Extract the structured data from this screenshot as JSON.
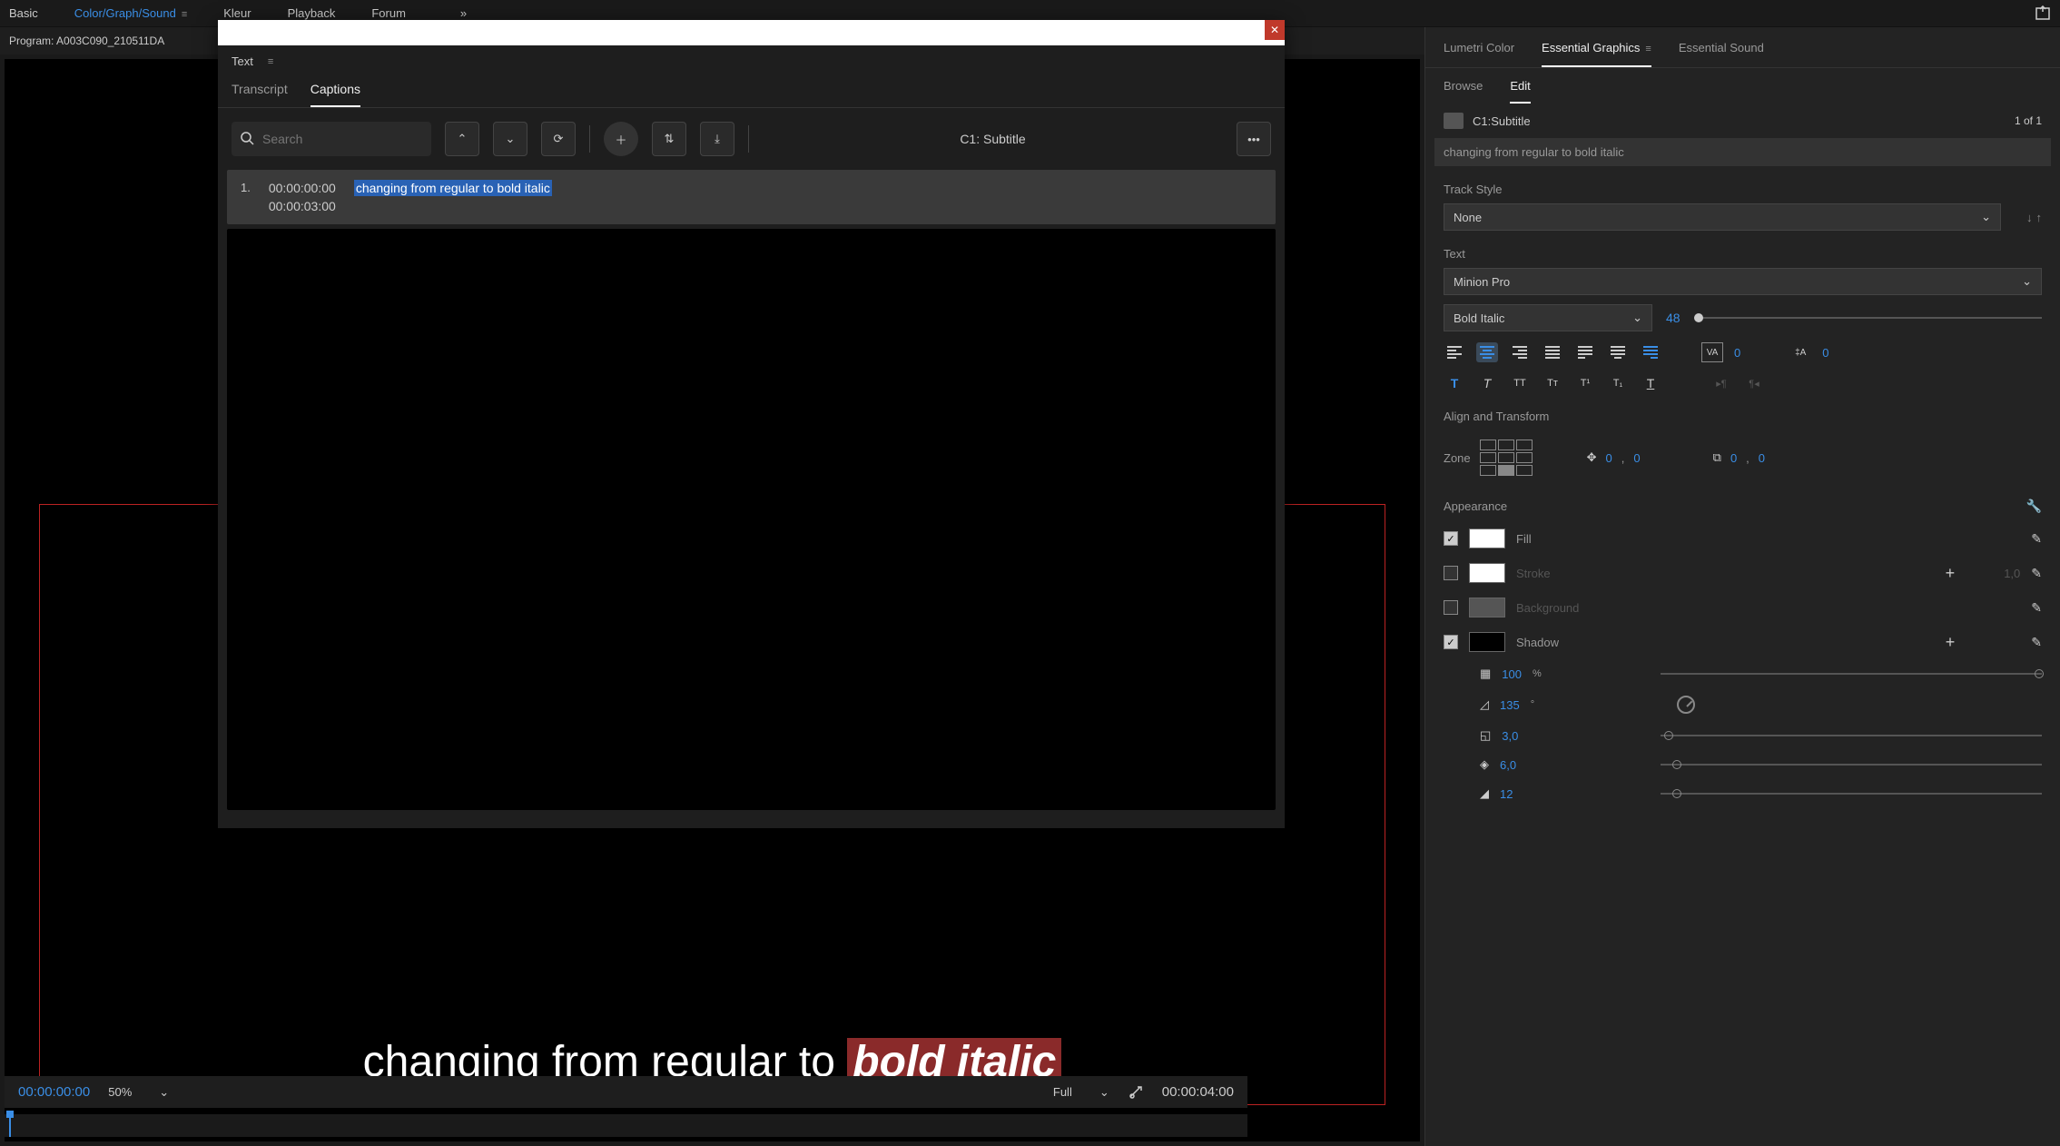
{
  "topbar": {
    "basic": "Basic",
    "cgs": "Color/Graph/Sound",
    "kleur": "Kleur",
    "playback": "Playback",
    "forum": "Forum"
  },
  "program_bar": "Program: A003C090_210511DA",
  "text_panel": {
    "title": "Text",
    "transcript": "Transcript",
    "captions": "Captions",
    "search_placeholder": "Search",
    "subtitle_track": "C1: Subtitle",
    "row_num": "1.",
    "in_tc": "00:00:00:00",
    "out_tc": "00:00:03:00",
    "caption_text": "changing from regular to bold italic"
  },
  "overlay": {
    "normal": "changing from regular to ",
    "bold": "bold italic"
  },
  "bottom": {
    "tc_left": "00:00:00:00",
    "zoom": "50%",
    "resolution": "Full",
    "tc_right": "00:00:04:00"
  },
  "right": {
    "lumetri": "Lumetri Color",
    "essential_graphics": "Essential Graphics",
    "essential_sound": "Essential Sound",
    "browse": "Browse",
    "edit": "Edit",
    "layer_name": "C1:Subtitle",
    "layer_count": "1 of 1",
    "layer_text": "changing from regular to bold italic",
    "track_style": "Track Style",
    "track_style_value": "None",
    "text_section": "Text",
    "font": "Minion Pro",
    "font_style": "Bold Italic",
    "font_size": "48",
    "tracking": "0",
    "leading": "0",
    "align_transform": "Align and Transform",
    "zone_label": "Zone",
    "pos_x": "0",
    "pos_y": "0",
    "scale_x": "0",
    "scale_y": "0",
    "appearance": "Appearance",
    "fill": "Fill",
    "stroke": "Stroke",
    "stroke_val": "1,0",
    "background": "Background",
    "shadow": "Shadow",
    "shadow_opacity": "100",
    "shadow_opacity_unit": "%",
    "shadow_angle": "135",
    "shadow_angle_unit": "°",
    "shadow_distance": "3,0",
    "shadow_size": "6,0",
    "shadow_blur": "12"
  }
}
